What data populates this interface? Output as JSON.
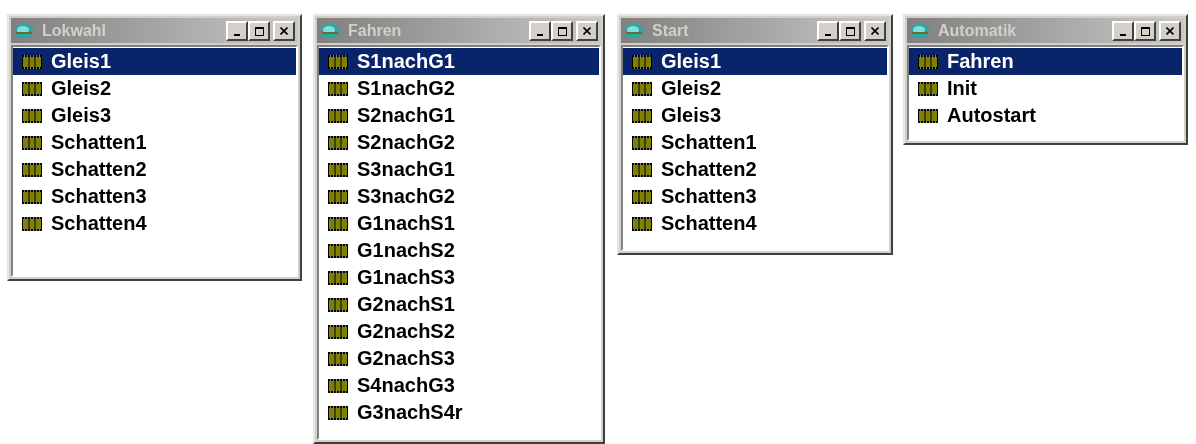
{
  "windows": [
    {
      "title": "Lokwahl",
      "items": [
        {
          "label": "Gleis1",
          "selected": true
        },
        {
          "label": "Gleis2",
          "selected": false
        },
        {
          "label": "Gleis3",
          "selected": false
        },
        {
          "label": "Schatten1",
          "selected": false
        },
        {
          "label": "Schatten2",
          "selected": false
        },
        {
          "label": "Schatten3",
          "selected": false
        },
        {
          "label": "Schatten4",
          "selected": false
        }
      ]
    },
    {
      "title": "Fahren",
      "items": [
        {
          "label": "S1nachG1",
          "selected": true
        },
        {
          "label": "S1nachG2",
          "selected": false
        },
        {
          "label": "S2nachG1",
          "selected": false
        },
        {
          "label": "S2nachG2",
          "selected": false
        },
        {
          "label": "S3nachG1",
          "selected": false
        },
        {
          "label": "S3nachG2",
          "selected": false
        },
        {
          "label": "G1nachS1",
          "selected": false
        },
        {
          "label": "G1nachS2",
          "selected": false
        },
        {
          "label": "G1nachS3",
          "selected": false
        },
        {
          "label": "G2nachS1",
          "selected": false
        },
        {
          "label": "G2nachS2",
          "selected": false
        },
        {
          "label": "G2nachS3",
          "selected": false
        },
        {
          "label": "S4nachG3",
          "selected": false
        },
        {
          "label": "G3nachS4r",
          "selected": false
        }
      ]
    },
    {
      "title": "Start",
      "items": [
        {
          "label": "Gleis1",
          "selected": true
        },
        {
          "label": "Gleis2",
          "selected": false
        },
        {
          "label": "Gleis3",
          "selected": false
        },
        {
          "label": "Schatten1",
          "selected": false
        },
        {
          "label": "Schatten2",
          "selected": false
        },
        {
          "label": "Schatten3",
          "selected": false
        },
        {
          "label": "Schatten4",
          "selected": false
        }
      ]
    },
    {
      "title": "Automatik",
      "items": [
        {
          "label": "Fahren",
          "selected": true
        },
        {
          "label": "Init",
          "selected": false
        },
        {
          "label": "Autostart",
          "selected": false
        }
      ]
    }
  ]
}
